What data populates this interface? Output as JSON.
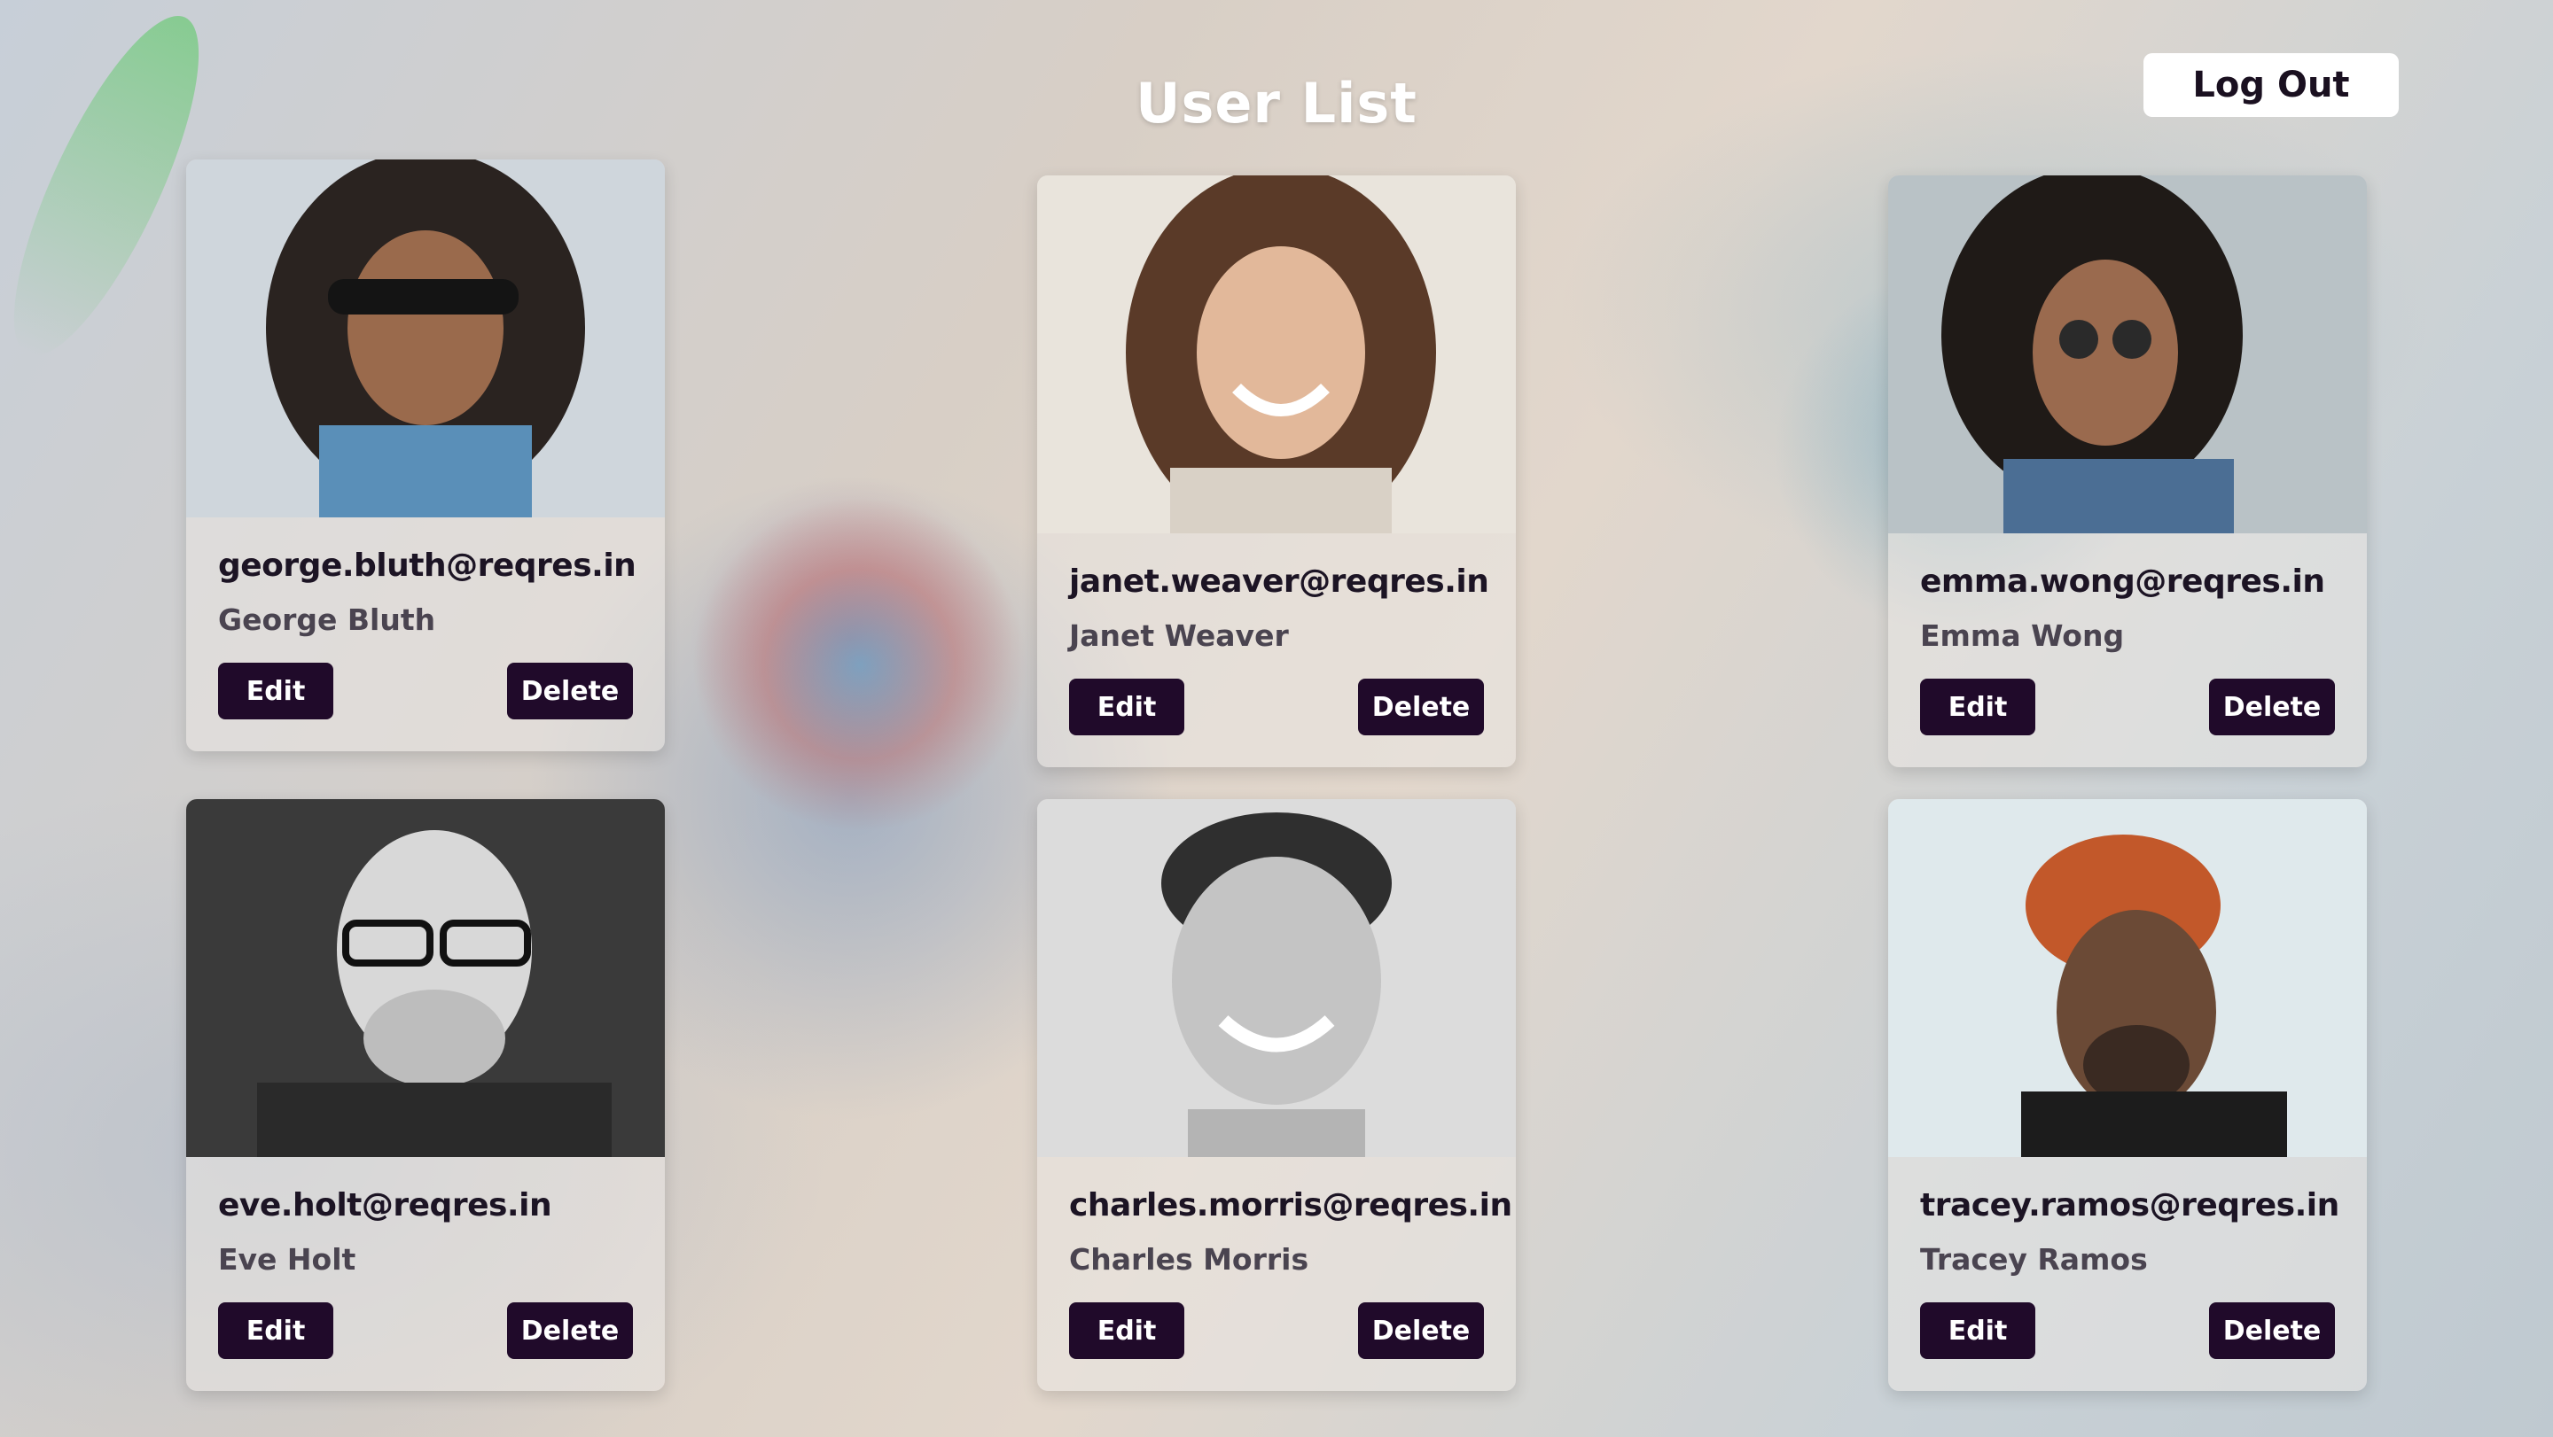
{
  "header": {
    "title": "User List",
    "logout_label": "Log Out"
  },
  "users": [
    {
      "email": "george.bluth@reqres.in",
      "name": "George Bluth",
      "edit_label": "Edit",
      "delete_label": "Delete"
    },
    {
      "email": "janet.weaver@reqres.in",
      "name": "Janet Weaver",
      "edit_label": "Edit",
      "delete_label": "Delete"
    },
    {
      "email": "emma.wong@reqres.in",
      "name": "Emma Wong",
      "edit_label": "Edit",
      "delete_label": "Delete"
    },
    {
      "email": "eve.holt@reqres.in",
      "name": "Eve Holt",
      "edit_label": "Edit",
      "delete_label": "Delete"
    },
    {
      "email": "charles.morris@reqres.in",
      "name": "Charles Morris",
      "edit_label": "Edit",
      "delete_label": "Delete"
    },
    {
      "email": "tracey.ramos@reqres.in",
      "name": "Tracey Ramos",
      "edit_label": "Edit",
      "delete_label": "Delete"
    }
  ],
  "colors": {
    "button_bg": "#200a2a",
    "button_text": "#ffffff",
    "title_text": "#ffffff"
  }
}
